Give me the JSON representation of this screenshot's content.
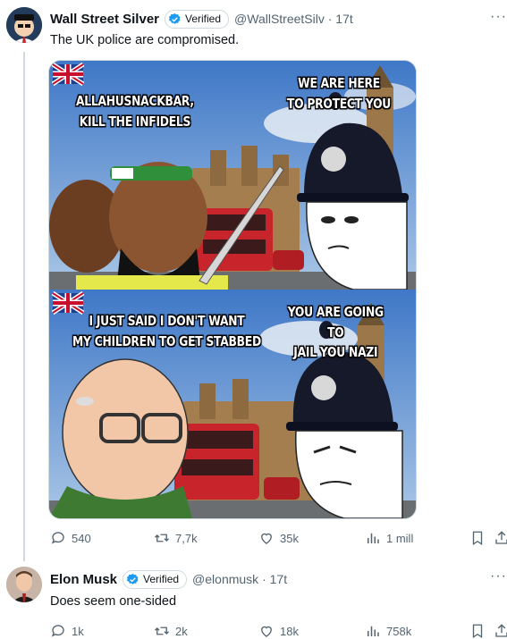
{
  "tweet1": {
    "author_name": "Wall Street Silver",
    "verified_label": "Verified",
    "handle_time": "@WallStreetSilv · 17t",
    "more": "···",
    "text": "The UK police are compromised.",
    "meme": {
      "panel1_left": [
        "ALLAHUSNACKBAR,",
        "KILL THE INFIDELS"
      ],
      "panel1_right": [
        "WE ARE HERE",
        "TO PROTECT YOU"
      ],
      "panel2_left": [
        "I JUST SAID I DON'T WANT",
        "MY CHILDREN TO GET STABBED"
      ],
      "panel2_right": [
        "YOU ARE GOING TO",
        "JAIL YOU NAZI"
      ]
    },
    "actions": {
      "replies": "540",
      "retweets": "7,7k",
      "likes": "35k",
      "views": "1 mill"
    }
  },
  "tweet2": {
    "author_name": "Elon Musk",
    "verified_label": "Verified",
    "handle_time": "@elonmusk · 17t",
    "more": "···",
    "text": "Does seem one-sided",
    "actions": {
      "replies": "1k",
      "retweets": "2k",
      "likes": "18k",
      "views": "758k"
    }
  },
  "colors": {
    "verified_blue": "#1d9bf0",
    "muted": "#536471",
    "border": "#cfd9de"
  }
}
